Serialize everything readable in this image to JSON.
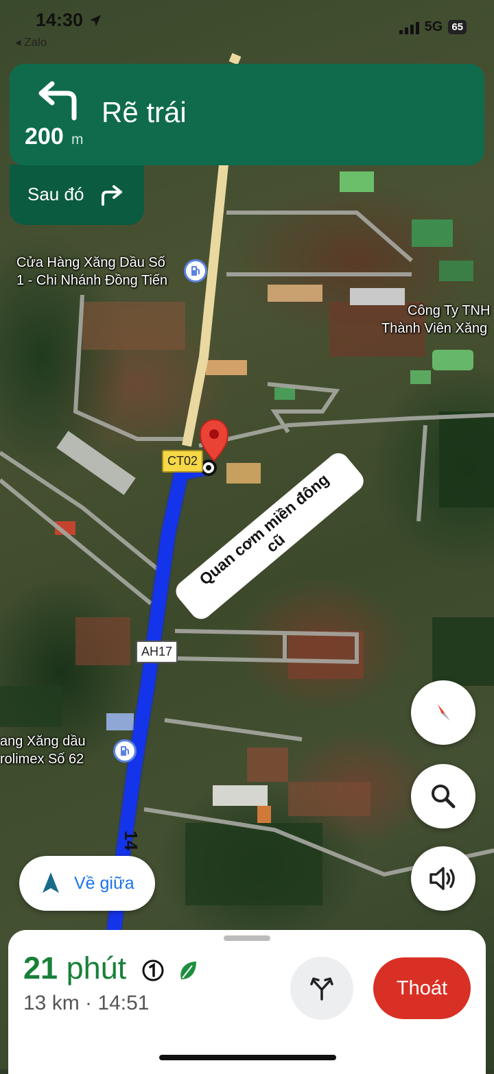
{
  "status_bar": {
    "time": "14:30",
    "back_app": "◂ Zalo",
    "network": "5G",
    "battery": "65"
  },
  "navigation": {
    "distance_value": "200",
    "distance_unit": "m",
    "instruction": "Rẽ trái",
    "then_label": "Sau đó",
    "turn_icon": "turn-left-icon",
    "then_icon": "turn-right-icon"
  },
  "map": {
    "poi_1_line1": "Cửa Hàng Xăng Dầu Số",
    "poi_1_line2": "1 - Chi Nhánh Đồng Tiến",
    "poi_2_line1": "Công Ty TNH",
    "poi_2_line2": "Thành Viên Xăng",
    "poi_3_line1": "ang Xăng dầu",
    "poi_3_line2": "rolimex Số 62",
    "road_ct02": "CT02",
    "road_ah17": "AH17",
    "road_14": "14",
    "destination_line1": "Quan cơm miền đông",
    "destination_line2": "cũ",
    "route_color": "#1a3cff",
    "road_color": "#e9d9a0"
  },
  "controls": {
    "recenter_label": "Về giữa",
    "compass_icon": "compass-icon",
    "search_icon": "search-icon",
    "sound_icon": "speaker-icon"
  },
  "trip": {
    "eta_number": "21",
    "eta_unit": "phút",
    "distance": "13 km",
    "separator": "·",
    "arrival": "14:51",
    "exit_label": "Thoát"
  },
  "colors": {
    "nav_green": "#0f6b4c",
    "eta_green": "#188038",
    "exit_red": "#d93025",
    "recenter_blue": "#1a73e8"
  }
}
